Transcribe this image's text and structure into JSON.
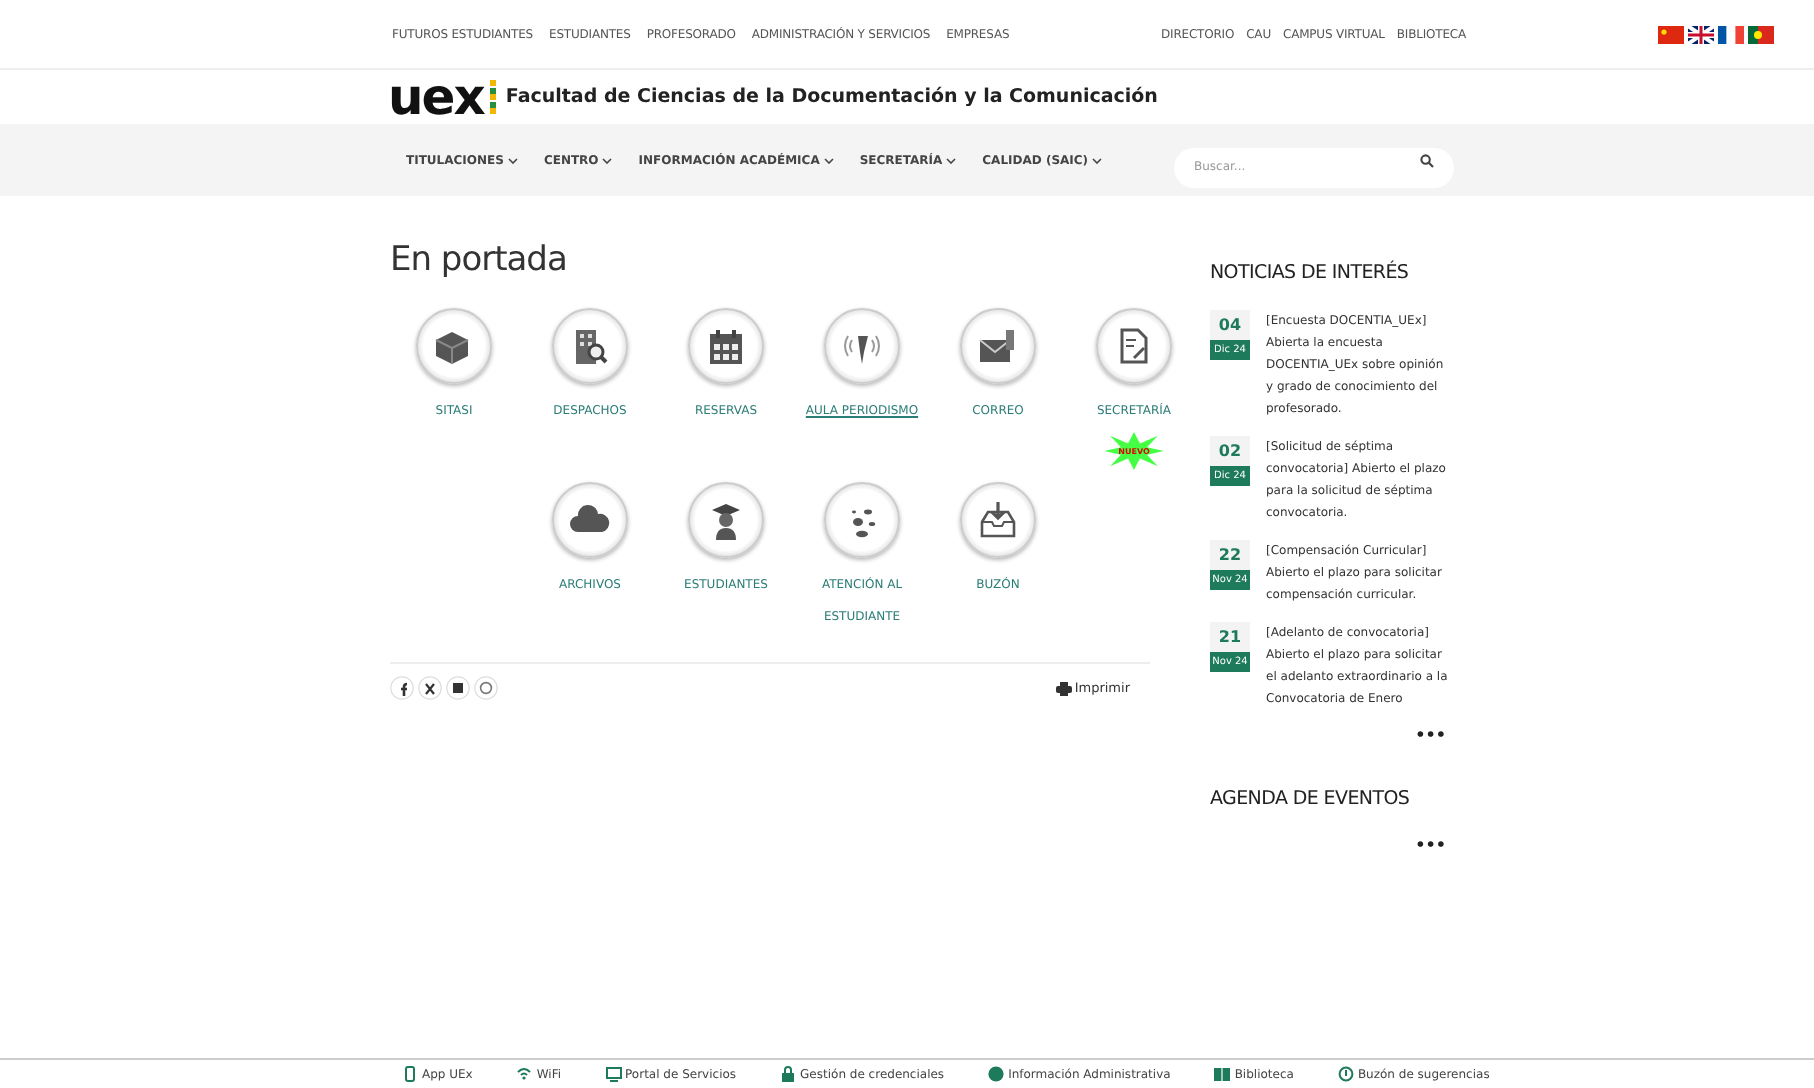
{
  "top_links": [
    "FUTUROS ESTUDIANTES",
    "ESTUDIANTES",
    "PROFESORADO",
    "ADMINISTRACIÓN Y SERVICIOS",
    "EMPRESAS"
  ],
  "right_links": [
    "DIRECTORIO",
    "CAU",
    "CAMPUS VIRTUAL",
    "BIBLIOTECA"
  ],
  "logo": "uex",
  "faculty": "Facultad de Ciencias de la Documentación y la Comunicación",
  "nav": [
    "TITULACIONES",
    "CENTRO",
    "INFORMACIÓN ACADÉMICA",
    "SECRETARÍA",
    "CALIDAD (SAIC)"
  ],
  "search": {
    "placeholder": "Buscar..."
  },
  "heading": "En portada",
  "tiles": [
    {
      "label": "SITASI",
      "underlined": false
    },
    {
      "label": "DESPACHOS",
      "underlined": false
    },
    {
      "label": "RESERVAS",
      "underlined": false
    },
    {
      "label": "AULA PERIODISMO",
      "underlined": true
    },
    {
      "label": "CORREO",
      "underlined": false
    },
    {
      "label": "SECRETARÍA",
      "underlined": false,
      "badge": "NUEVO"
    },
    {
      "label": "ARCHIVOS",
      "underlined": false
    },
    {
      "label": "ESTUDIANTES",
      "underlined": false
    },
    {
      "label": "ATENCIÓN AL ESTUDIANTE",
      "underlined": false
    },
    {
      "label": "BUZÓN",
      "underlined": false
    }
  ],
  "print": "Imprimir",
  "news_title": "NOTICIAS DE INTERÉS",
  "news": [
    {
      "day": "04",
      "month": "Dic 24",
      "text": "[Encuesta DOCENTIA_UEx] Abierta la encuesta DOCENTIA_UEx sobre opinión y grado de conocimiento del profesorado."
    },
    {
      "day": "02",
      "month": "Dic 24",
      "text": "[Solicitud de séptima convocatoria] Abierto el plazo para la solicitud de séptima convocatoria."
    },
    {
      "day": "22",
      "month": "Nov 24",
      "text": "[Compensación Curricular] Abierto el plazo para solicitar compensación curricular."
    },
    {
      "day": "21",
      "month": "Nov 24",
      "text": "[Adelanto de convocatoria] Abierto el plazo para solicitar el adelanto extraordinario a la Convocatoria de Enero"
    }
  ],
  "news_more": "•••",
  "agenda_title": "AGENDA DE EVENTOS",
  "agenda_more": "•••",
  "footer": [
    "App UEx",
    "WiFi",
    "Portal de Servicios",
    "Gestión de credenciales",
    "Información Administrativa",
    "Biblioteca",
    "Buzón de sugerencias"
  ]
}
